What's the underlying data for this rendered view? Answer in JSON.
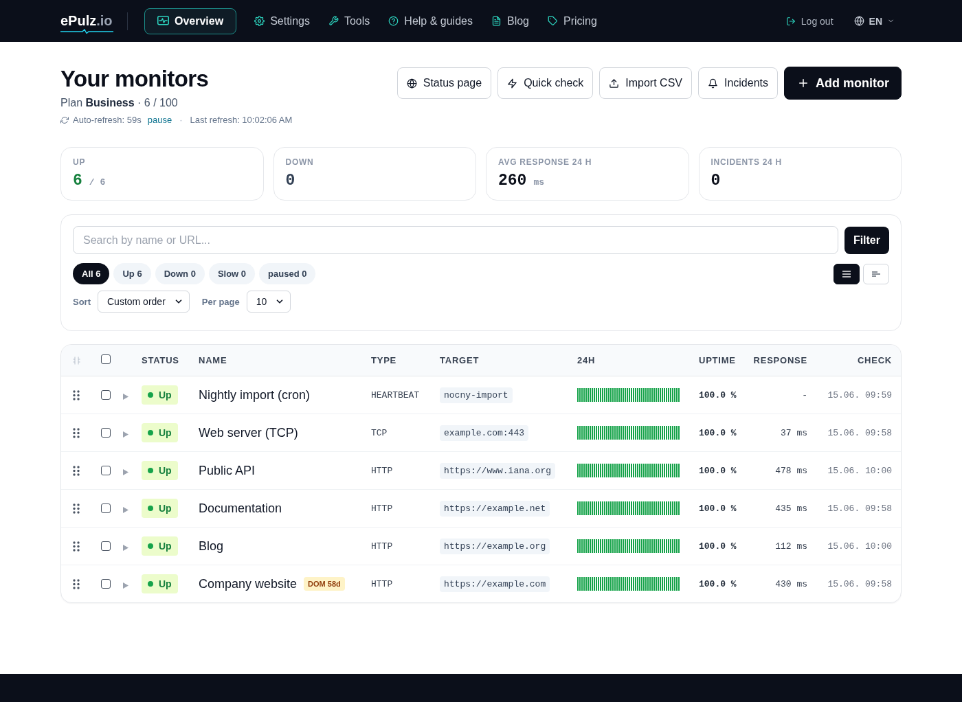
{
  "brand": {
    "name": "ePulz",
    "suffix": ".io"
  },
  "nav": [
    {
      "label": "Overview",
      "selected": true
    },
    {
      "label": "Settings",
      "selected": false
    },
    {
      "label": "Tools",
      "selected": false
    },
    {
      "label": "Help & guides",
      "selected": false
    },
    {
      "label": "Blog",
      "selected": false
    },
    {
      "label": "Pricing",
      "selected": false
    }
  ],
  "account": {
    "logout": "Log out",
    "language": "EN"
  },
  "page": {
    "title": "Your monitors",
    "plan": "Plan **Business** · 6 / 100",
    "auto_refresh": "Auto-refresh: 59s",
    "pause": "pause",
    "separator": "·",
    "last_refresh": "Last refresh: 10:02:06 AM"
  },
  "actions": [
    {
      "label": "Status page",
      "primary": false
    },
    {
      "label": "Quick check",
      "primary": false
    },
    {
      "label": "Import CSV",
      "primary": false
    },
    {
      "label": "Incidents",
      "primary": false
    },
    {
      "label": "Add monitor",
      "primary": true
    }
  ],
  "stats": [
    {
      "label": "UP",
      "value": "6",
      "unit": "/ 6",
      "color": "#15803d"
    },
    {
      "label": "DOWN",
      "value": "0",
      "color": "#334155"
    },
    {
      "label": "AVG RESPONSE 24 H",
      "value": "260",
      "unit": "ms",
      "color": "#0b0f1a"
    },
    {
      "label": "INCIDENTS 24 H",
      "value": "0",
      "color": "#0b0f1a"
    }
  ],
  "filters": {
    "search": {
      "placeholder": "Search by name or URL..."
    },
    "filter_button": "Filter",
    "chips": [
      {
        "label": "All 6",
        "selected": true
      },
      {
        "label": "Up 6",
        "selected": false
      },
      {
        "label": "Down 0",
        "selected": false
      },
      {
        "label": "Slow 0",
        "selected": false
      },
      {
        "label": "paused 0",
        "selected": false
      }
    ],
    "view_modes": [
      {
        "selected": true
      },
      {
        "selected": false
      }
    ],
    "sort": {
      "label": "Sort",
      "value": "Custom order"
    },
    "per_page": {
      "label": "Per page",
      "value": "10"
    }
  },
  "table": {
    "select_all": {
      "checked": false
    },
    "columns": [
      "STATUS",
      "NAME",
      "TYPE",
      "TARGET",
      "24H",
      "UPTIME",
      "RESPONSE",
      "CHECK"
    ],
    "rows": [
      {
        "name": "Nightly import (cron)",
        "status": "Up",
        "kind": "up",
        "type": "HEARTBEAT",
        "target": "nocny-import",
        "uptime": "100.0 %",
        "response": "-",
        "check": "15.06. 09:59",
        "checked": false,
        "expanded": false
      },
      {
        "name": "Web server (TCP)",
        "status": "Up",
        "kind": "up",
        "type": "TCP",
        "target": "example.com:443",
        "uptime": "100.0 %",
        "response": "37 ms",
        "check": "15.06. 09:58",
        "checked": false,
        "expanded": false
      },
      {
        "name": "Public API",
        "status": "Up",
        "kind": "up",
        "type": "HTTP",
        "target": "https://www.iana.org",
        "uptime": "100.0 %",
        "response": "478 ms",
        "check": "15.06. 10:00",
        "checked": false,
        "expanded": false
      },
      {
        "name": "Documentation",
        "status": "Up",
        "kind": "up",
        "type": "HTTP",
        "target": "https://example.net",
        "uptime": "100.0 %",
        "response": "435 ms",
        "check": "15.06. 09:58",
        "checked": false,
        "expanded": false
      },
      {
        "name": "Blog",
        "status": "Up",
        "kind": "up",
        "type": "HTTP",
        "target": "https://example.org",
        "uptime": "100.0 %",
        "response": "112 ms",
        "check": "15.06. 10:00",
        "checked": false,
        "expanded": false
      },
      {
        "name": "Company website",
        "badge": "DOM 58d",
        "status": "Up",
        "kind": "up",
        "type": "HTTP",
        "target": "https://example.com",
        "uptime": "100.0 %",
        "response": "430 ms",
        "check": "15.06. 09:58",
        "checked": false,
        "expanded": false
      }
    ]
  }
}
